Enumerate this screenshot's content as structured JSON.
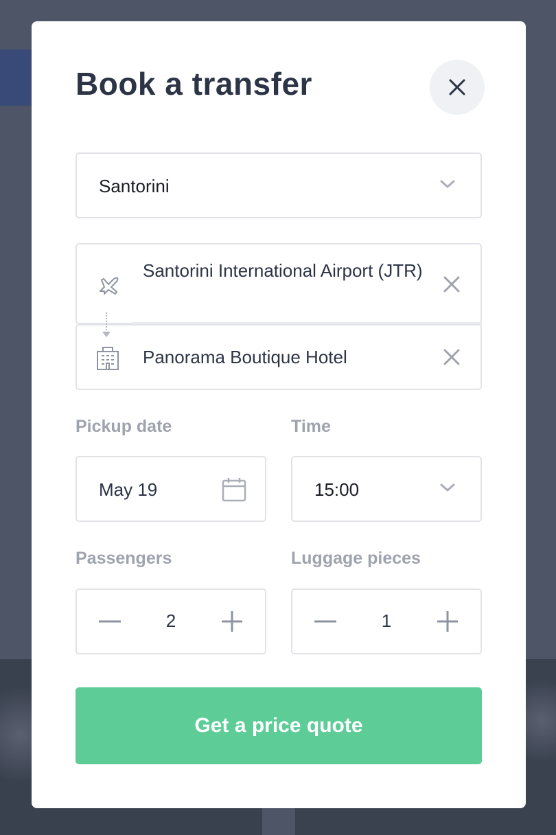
{
  "modal": {
    "title": "Book a transfer"
  },
  "region_select": {
    "value": "Santorini"
  },
  "pickup_location": {
    "name": "Santorini International Airport (JTR)",
    "icon": "airplane-icon"
  },
  "dropoff_location": {
    "name": "Panorama Boutique Hotel",
    "icon": "building-icon"
  },
  "pickup_date": {
    "label": "Pickup date",
    "value": "May 19",
    "icon": "calendar-icon"
  },
  "time": {
    "label": "Time",
    "value": "15:00"
  },
  "passengers": {
    "label": "Passengers",
    "value": "2"
  },
  "luggage": {
    "label": "Luggage pieces",
    "value": "1"
  },
  "cta": {
    "label": "Get a price quote"
  },
  "colors": {
    "accent_green": "#5dcc97",
    "title_text": "#2c3446",
    "label_gray": "#9ea3ad",
    "overlay": "#4d5566"
  }
}
